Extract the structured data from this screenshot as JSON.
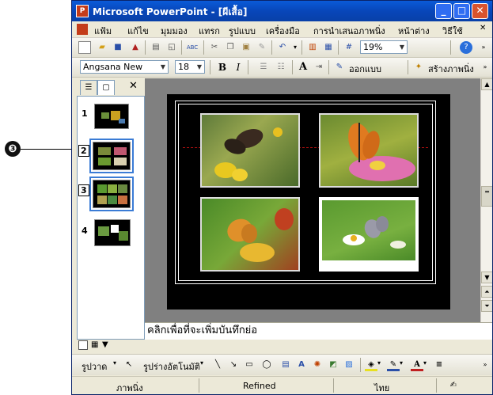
{
  "callout": {
    "number": "❸"
  },
  "window": {
    "title": "Microsoft PowerPoint - [ผีเสื้อ]",
    "icon_letter": "P",
    "controls": {
      "minimize": "_",
      "maximize": "□",
      "close": "✕"
    }
  },
  "menu": {
    "items": [
      "แฟ้ม",
      "แก้ไข",
      "มุมมอง",
      "แทรก",
      "รูปแบบ",
      "เครื่องมือ",
      "การนำเสนอภาพนิ่ง",
      "หน้าต่าง",
      "วิธีใช้"
    ]
  },
  "toolbar": {
    "zoom": "19%",
    "font": "Angsana New",
    "font_size": "18",
    "bold": "B",
    "italic": "I",
    "font_grow": "A",
    "design_label": "ออกแบบ",
    "new_slide_label": "สร้างภาพนิ่ง"
  },
  "slide_pane": {
    "slides": [
      {
        "number": "1",
        "selected": false
      },
      {
        "number": "2",
        "selected": true
      },
      {
        "number": "3",
        "selected": true
      },
      {
        "number": "4",
        "selected": false
      }
    ],
    "close": "✕"
  },
  "notes": {
    "placeholder": "คลิกเพื่อที่จะเพิ่มบันทึกย่อ"
  },
  "draw_toolbar": {
    "draw_label": "รูปวาด",
    "autoshapes_label": "รูปร่างอัตโนมัติ"
  },
  "status": {
    "slide_label": "ภาพนิ่ง",
    "design": "Refined",
    "language": "ไทย"
  },
  "colors": {
    "title_blue": "#0846b9",
    "selection_blue": "#3a7bd5",
    "slide_bg": "#000000",
    "edit_bg": "#808080"
  }
}
